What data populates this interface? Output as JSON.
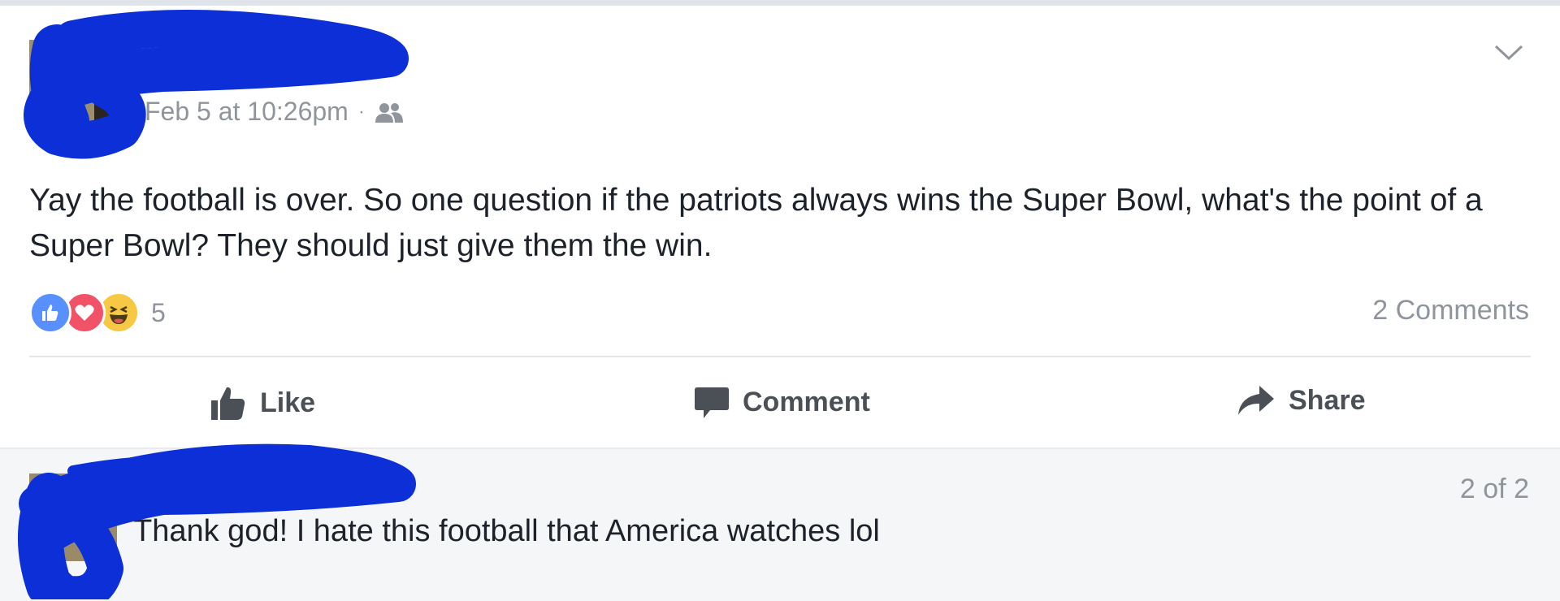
{
  "post": {
    "author": "",
    "timestamp": "Feb 5 at 10:26pm",
    "separator": "·",
    "audience_icon": "friends-icon",
    "menu_icon": "chevron-down-icon",
    "text": "Yay the football is over. So one question if the patriots always wins the Super Bowl, what's the point of a Super Bowl? They should just give them the win.",
    "reactions": [
      "like",
      "love",
      "haha"
    ],
    "reaction_count": "5",
    "comments_count": "2 Comments",
    "actions": {
      "like": "Like",
      "comment": "Comment",
      "share": "Share"
    }
  },
  "comment": {
    "author": "",
    "text": "Thank god! I hate this football that America watches lol",
    "pager": "2 of 2"
  },
  "colors": {
    "link": "#3b5998",
    "muted": "#90949c",
    "like_blue": "#5890ff",
    "love_red": "#f25268",
    "haha_yellow": "#f7c844",
    "redaction_blue": "#0c2fd8"
  }
}
